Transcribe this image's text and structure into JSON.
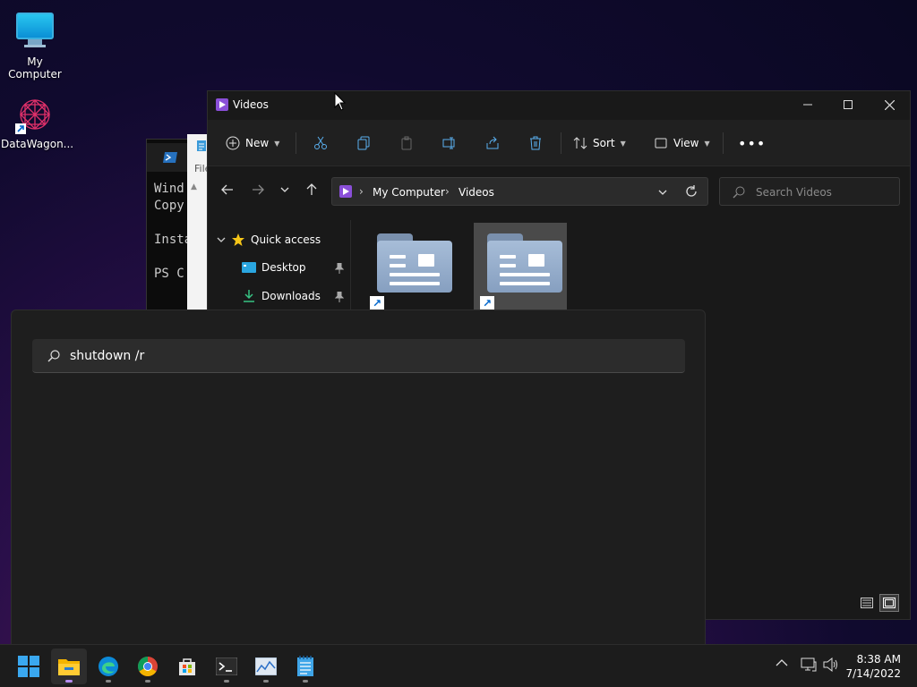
{
  "desktop": {
    "icons": [
      {
        "label": "My Computer"
      },
      {
        "label": "DataWagon..."
      }
    ]
  },
  "powershell": {
    "lines": [
      "Wind",
      "Copy",
      "",
      "Insta",
      "",
      "PS C"
    ]
  },
  "notepad": {
    "menu_label": "File"
  },
  "explorer": {
    "title": "Videos",
    "toolbar": {
      "new_label": "New",
      "sort_label": "Sort",
      "view_label": "View"
    },
    "address": {
      "root": "My Computer",
      "current": "Videos"
    },
    "search_placeholder": "Search Videos",
    "nav": {
      "quick_access": "Quick access",
      "items": [
        {
          "label": "Desktop"
        },
        {
          "label": "Downloads"
        }
      ]
    }
  },
  "run": {
    "query": "shutdown /r"
  },
  "taskbar": {
    "time": "8:38 AM",
    "date": "7/14/2022"
  },
  "colors": {
    "accent": "#b58cf0",
    "folder": "#a7bdd8",
    "selection": "#4a4a4a"
  }
}
